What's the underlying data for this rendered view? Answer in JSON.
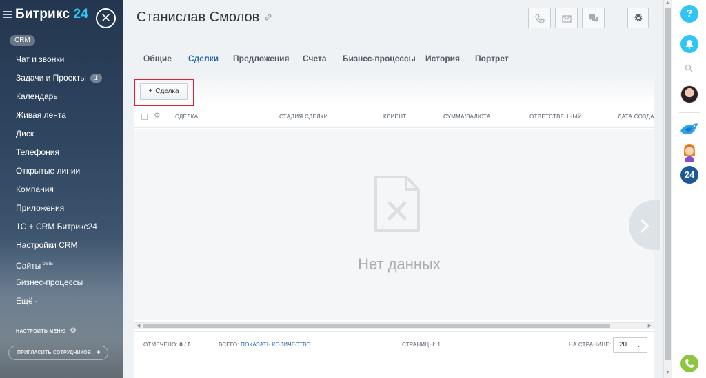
{
  "sidebar": {
    "logo_main": "Битрикс",
    "logo_num": "24",
    "section_pill": "CRM",
    "items": [
      {
        "label": "Чат и звонки"
      },
      {
        "label": "Задачи и Проекты",
        "count": "1"
      },
      {
        "label": "Календарь"
      },
      {
        "label": "Живая лента"
      },
      {
        "label": "Диск"
      },
      {
        "label": "Телефония"
      },
      {
        "label": "Открытые линии"
      },
      {
        "label": "Компания"
      },
      {
        "label": "Приложения"
      },
      {
        "label": "1С + CRM Битрикс24"
      },
      {
        "label": "Настройки CRM"
      },
      {
        "label": "Сайты",
        "badge": "beta"
      },
      {
        "label": "Бизнес-процессы"
      },
      {
        "label": "Ещё -"
      }
    ],
    "configure_menu": "НАСТРОИТЬ МЕНЮ",
    "invite": "ПРИГЛАСИТЬ СОТРУДНИКОВ"
  },
  "header": {
    "title": "Станислав Смолов"
  },
  "tabs": [
    {
      "label": "Общие",
      "active": false
    },
    {
      "label": "Сделки",
      "active": true
    },
    {
      "label": "Предложения",
      "active": false
    },
    {
      "label": "Счета",
      "active": false
    },
    {
      "label": "Бизнес-процессы",
      "active": false
    },
    {
      "label": "История",
      "active": false
    },
    {
      "label": "Портрет",
      "active": false
    }
  ],
  "grid": {
    "add_button": "Сделка",
    "columns": [
      "СДЕЛКА",
      "СТАДИЯ СДЕЛКИ",
      "КЛИЕНТ",
      "СУММА/ВАЛЮТА",
      "ОТВЕТСТВЕННЫЙ",
      "ДАТА СОЗДА"
    ],
    "empty_text": "Нет данных",
    "footer": {
      "selected_label": "ОТМЕЧЕНО:",
      "selected_value": "0 / 0",
      "total_label": "ВСЕГО:",
      "total_link": "ПОКАЗАТЬ КОЛИЧЕСТВО",
      "pages_label": "СТРАНИЦЫ:",
      "pages_value": "1",
      "per_page_label": "НА СТРАНИЦЕ:",
      "per_page_value": "20"
    }
  },
  "rail": {
    "help_label": "?",
    "b24_label": "24"
  },
  "colors": {
    "accent": "#2067b0",
    "highlight_border": "#e0222d",
    "rail_blue": "#2fc6f6",
    "phone_green": "#8cc63f"
  }
}
